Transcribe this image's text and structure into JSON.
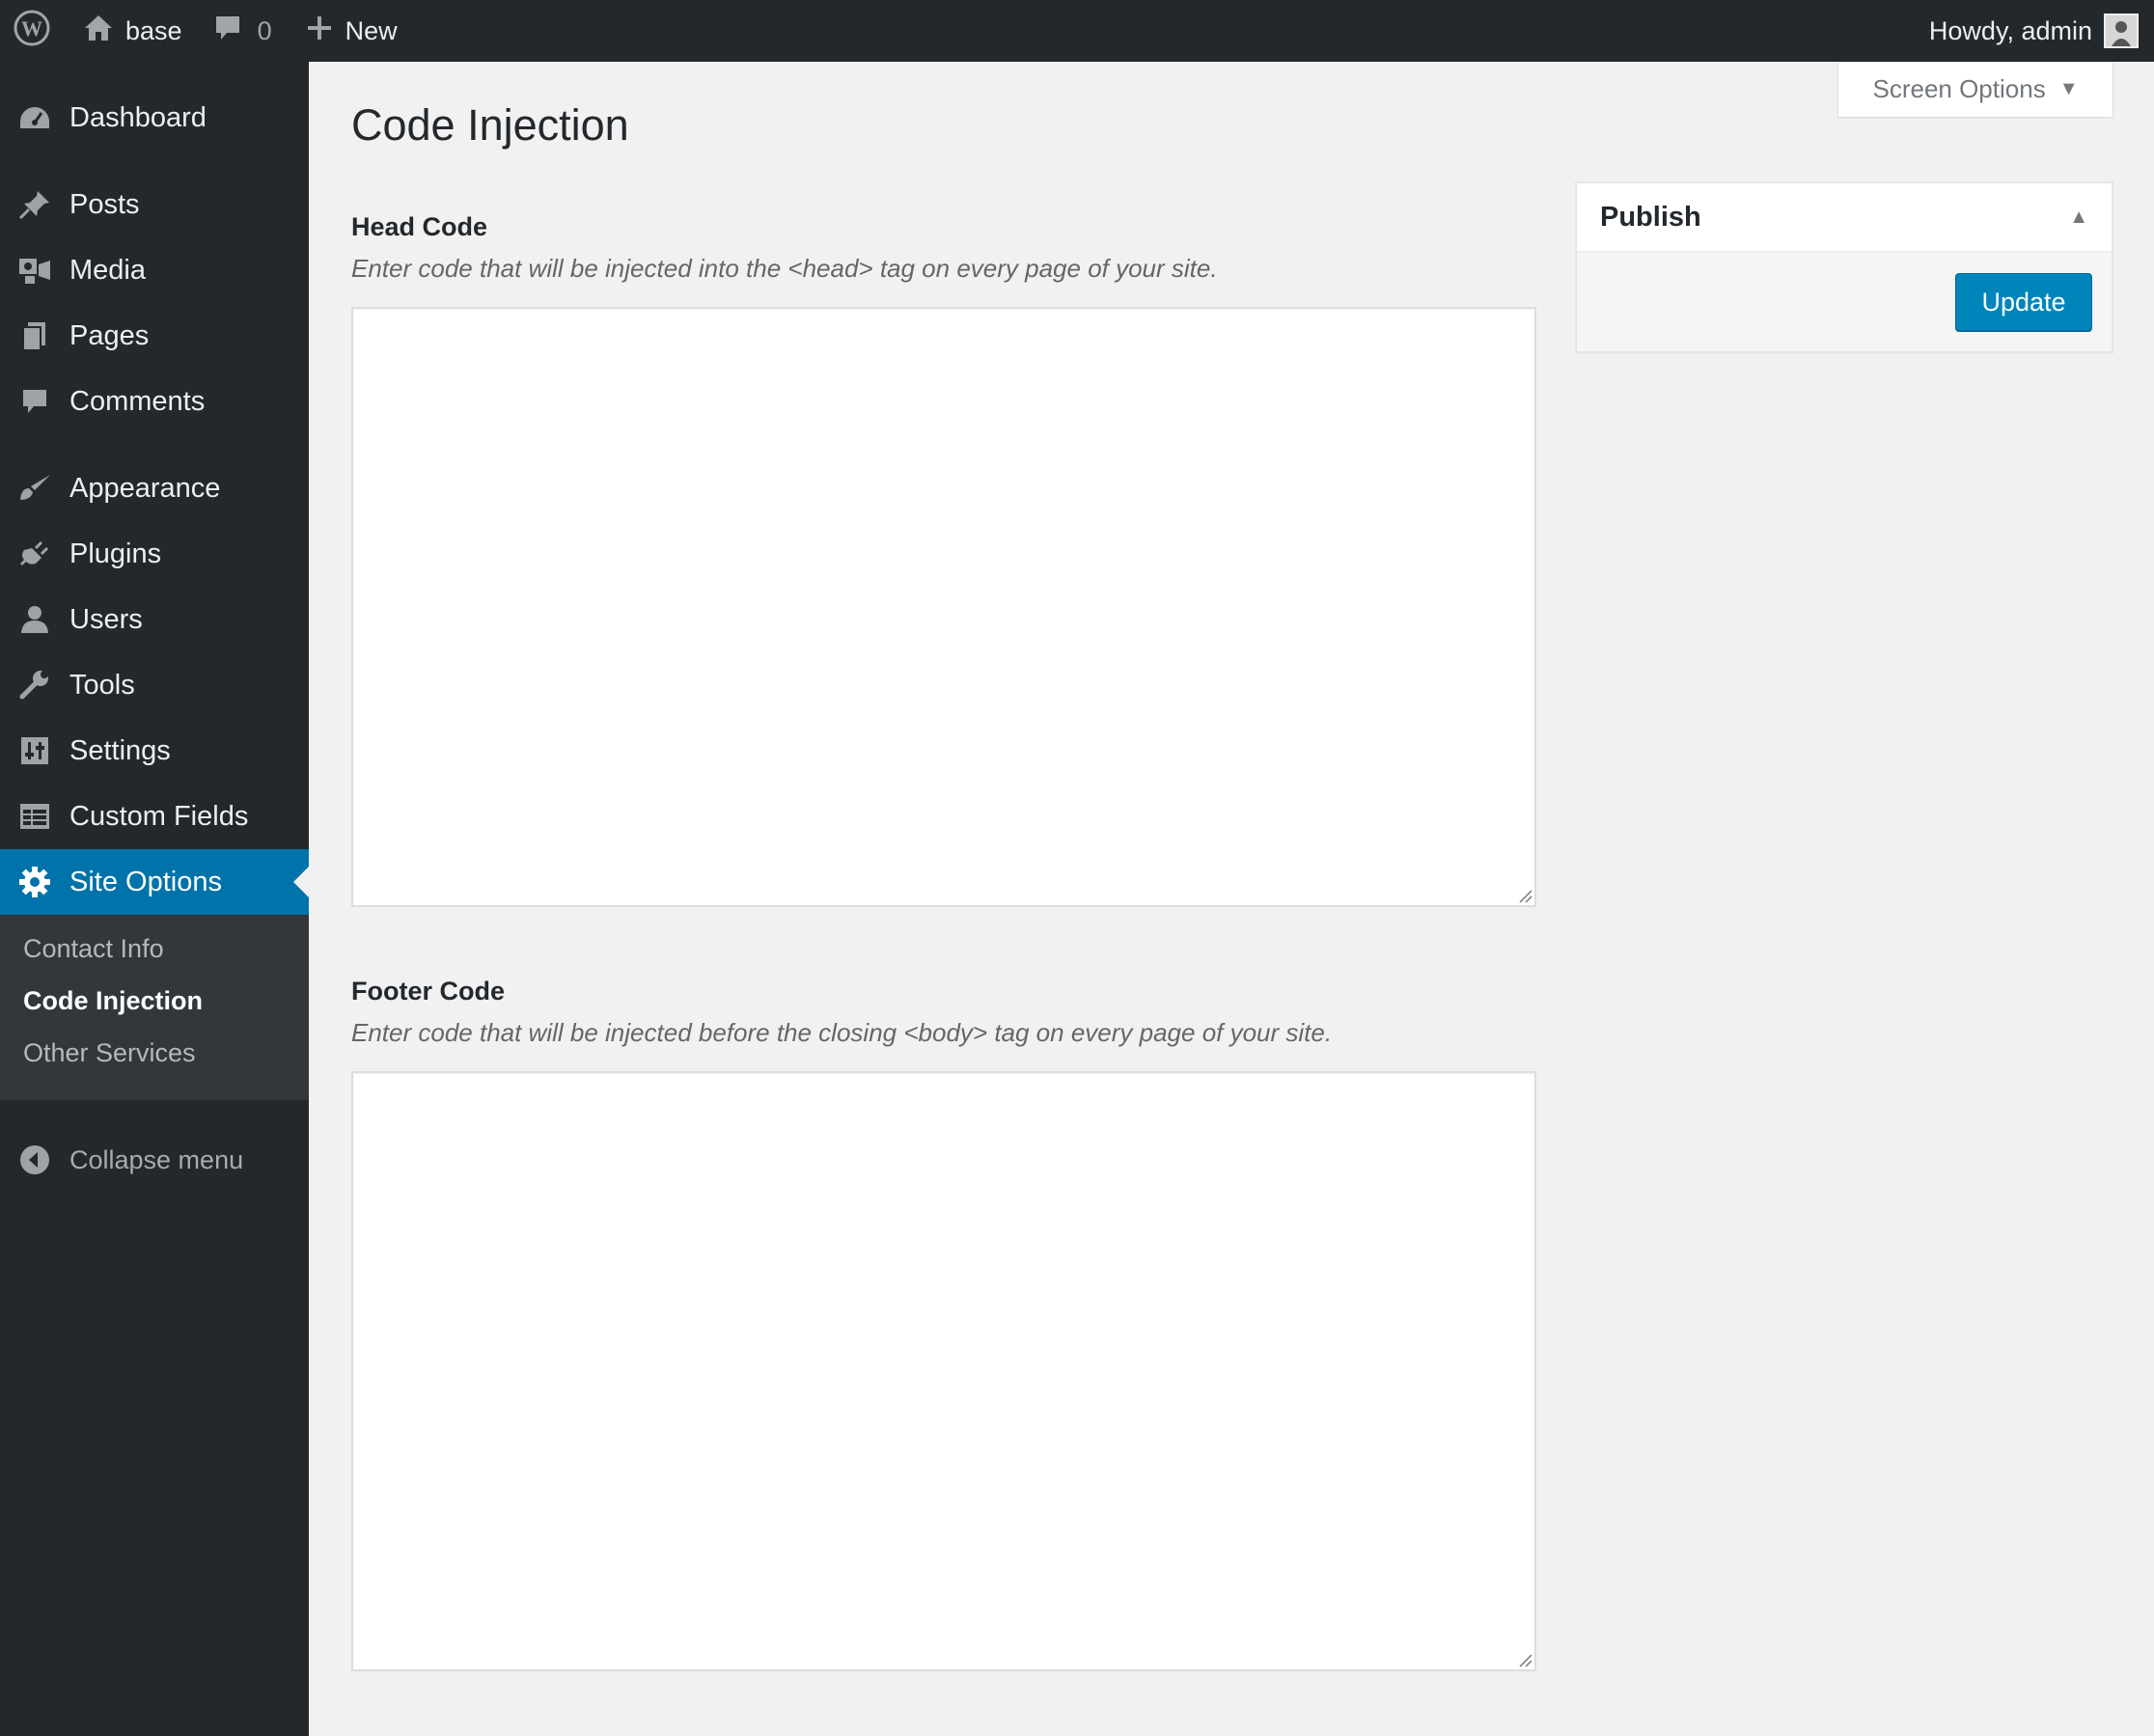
{
  "admin_bar": {
    "site_name": "base",
    "comments_count": "0",
    "new_label": "New",
    "account_label": "Howdy, admin"
  },
  "sidebar": {
    "items": [
      {
        "label": "Dashboard",
        "icon": "dashboard-icon"
      },
      {
        "label": "Posts",
        "icon": "pin-icon"
      },
      {
        "label": "Media",
        "icon": "media-icon"
      },
      {
        "label": "Pages",
        "icon": "pages-icon"
      },
      {
        "label": "Comments",
        "icon": "comment-icon"
      },
      {
        "label": "Appearance",
        "icon": "brush-icon"
      },
      {
        "label": "Plugins",
        "icon": "plug-icon"
      },
      {
        "label": "Users",
        "icon": "user-icon"
      },
      {
        "label": "Tools",
        "icon": "wrench-icon"
      },
      {
        "label": "Settings",
        "icon": "settings-icon"
      },
      {
        "label": "Custom Fields",
        "icon": "table-icon"
      },
      {
        "label": "Site Options",
        "icon": "gear-icon"
      }
    ],
    "submenu": [
      {
        "label": "Contact Info"
      },
      {
        "label": "Code Injection"
      },
      {
        "label": "Other Services"
      }
    ],
    "collapse_label": "Collapse menu"
  },
  "screen_options": {
    "label": "Screen Options"
  },
  "page": {
    "title": "Code Injection"
  },
  "fields": {
    "head": {
      "label": "Head Code",
      "description": "Enter code that will be injected into the <head> tag on every page of your site.",
      "value": ""
    },
    "footer": {
      "label": "Footer Code",
      "description": "Enter code that will be injected before the closing <body> tag on every page of your site.",
      "value": ""
    }
  },
  "publish": {
    "title": "Publish",
    "update_label": "Update"
  },
  "colors": {
    "admin_dark": "#23282d",
    "accent": "#0073aa",
    "button": "#0085ba",
    "background": "#f1f1f1"
  }
}
